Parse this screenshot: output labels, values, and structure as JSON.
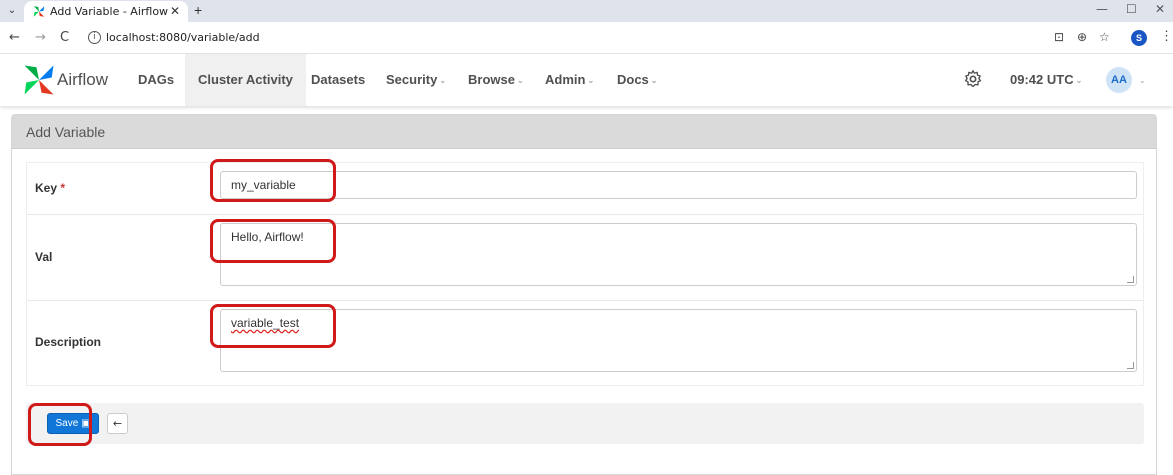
{
  "browser": {
    "tab_title": "Add Variable - Airflow",
    "tab_close": "✕",
    "new_tab": "+",
    "tab_menu": "⌄",
    "url": "localhost:8080/variable/add",
    "back": "←",
    "forward": "→",
    "reload": "C",
    "profile_initial": "S",
    "minimize": "—",
    "maximize": "☐",
    "close": "✕"
  },
  "navbar": {
    "brand": "Airflow",
    "items": [
      {
        "label": "DAGs",
        "dropdown": false,
        "active": false
      },
      {
        "label": "Cluster Activity",
        "dropdown": false,
        "active": true
      },
      {
        "label": "Datasets",
        "dropdown": false,
        "active": false
      },
      {
        "label": "Security",
        "dropdown": true,
        "active": false
      },
      {
        "label": "Browse",
        "dropdown": true,
        "active": false
      },
      {
        "label": "Admin",
        "dropdown": true,
        "active": false
      },
      {
        "label": "Docs",
        "dropdown": true,
        "active": false
      }
    ],
    "time": "09:42 UTC",
    "user_initials": "AA",
    "caret": "⌄"
  },
  "form": {
    "title": "Add Variable",
    "key_label": "Key",
    "required_marker": "*",
    "key_value": "my_variable",
    "val_label": "Val",
    "val_value": "Hello, Airflow!",
    "description_label": "Description",
    "description_value": "variable_test",
    "save_label": "Save",
    "back_symbol": "←"
  },
  "colors": {
    "accent": "#1077d9",
    "highlight": "#d01919",
    "navbar_text": "#51504f"
  }
}
